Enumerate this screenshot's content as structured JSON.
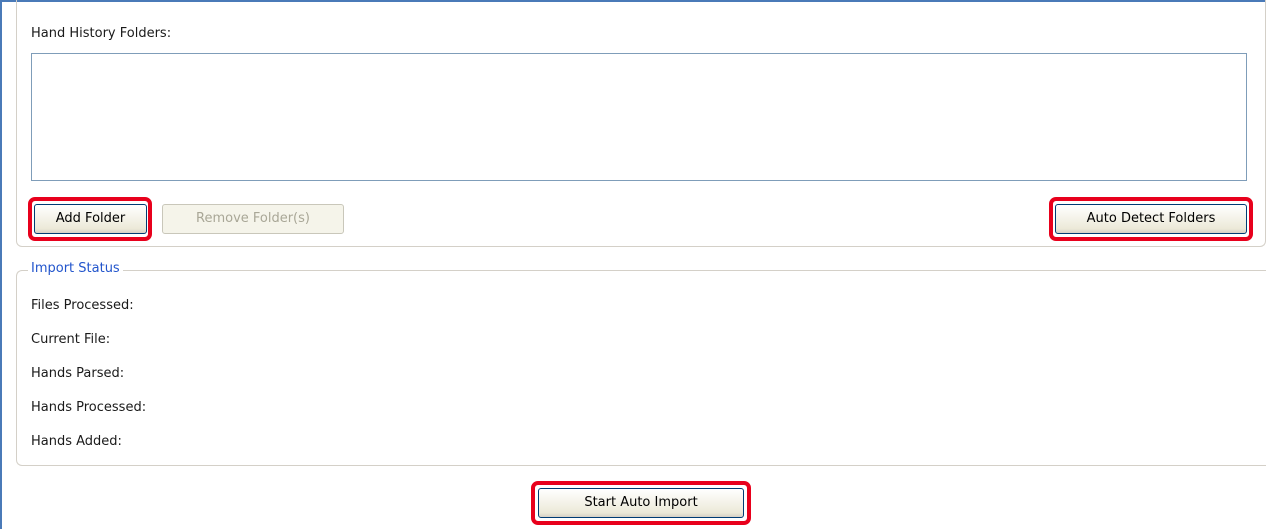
{
  "hand_history": {
    "label": "Hand History Folders:",
    "folders": []
  },
  "buttons": {
    "add_folder": "Add Folder",
    "remove_folders": "Remove Folder(s)",
    "auto_detect": "Auto Detect Folders",
    "start_import": "Start Auto Import"
  },
  "import_status": {
    "legend": "Import Status",
    "fields": [
      {
        "label": "Files Processed:",
        "value": ""
      },
      {
        "label": "Current File:",
        "value": ""
      },
      {
        "label": "Hands Parsed:",
        "value": ""
      },
      {
        "label": "Hands Processed:",
        "value": ""
      },
      {
        "label": "Hands Added:",
        "value": ""
      }
    ]
  },
  "colors": {
    "highlight": "#e8001c",
    "legend_text": "#2255cc",
    "window_border": "#4a7ab8"
  }
}
